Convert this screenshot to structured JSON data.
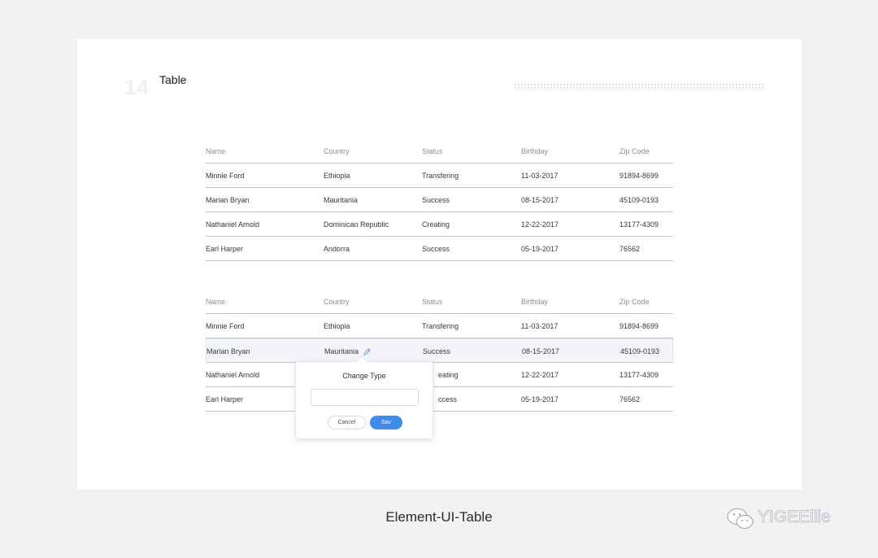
{
  "section": {
    "number": "14",
    "title": "Table"
  },
  "columns": [
    "Name",
    "Country",
    "Status",
    "Birthday",
    "Zip Code"
  ],
  "table1": {
    "rows": [
      [
        "Minnie Ford",
        "Ethiopia",
        "Transfering",
        "11-03-2017",
        "91894-8699"
      ],
      [
        "Marian Bryan",
        "Mauritania",
        "Success",
        "08-15-2017",
        "45109-0193"
      ],
      [
        "Nathaniel Arnold",
        "Dominican Republic",
        "Creating",
        "12-22-2017",
        "13177-4309"
      ],
      [
        "Earl Harper",
        "Andorra",
        "Success",
        "05-19-2017",
        "76562"
      ]
    ]
  },
  "table2": {
    "rows": [
      [
        "Minnie Ford",
        "Ethiopia",
        "Transfering",
        "11-03-2017",
        "91894-8699"
      ],
      [
        "Marian Bryan",
        "Mauritania",
        "Success",
        "08-15-2017",
        "45109-0193"
      ],
      [
        "Nathaniel Arnold",
        "",
        "eating",
        "12-22-2017",
        "13177-4309"
      ],
      [
        "Earl Harper",
        "",
        "ccess",
        "05-19-2017",
        "76562"
      ]
    ]
  },
  "popover": {
    "title": "Change Type",
    "input_value": "",
    "cancel_label": "Cancel",
    "save_label": "Sav"
  },
  "caption": "Element-UI-Table",
  "watermark": "YIGEEllie",
  "colors": {
    "accent": "#3b8cf0",
    "edit_icon": "#5b9df5"
  }
}
